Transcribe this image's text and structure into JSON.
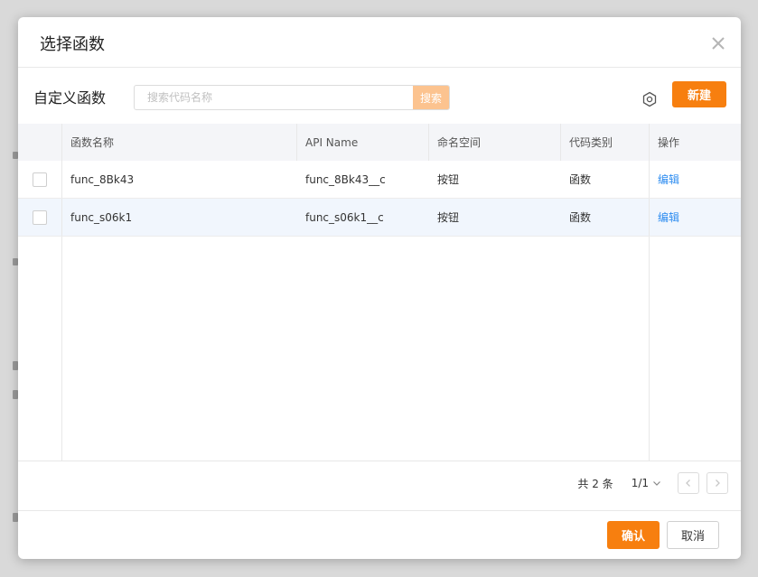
{
  "dialog": {
    "title": "选择函数"
  },
  "toolbar": {
    "title": "自定义函数",
    "search_placeholder": "搜索代码名称",
    "search_label": "搜索",
    "new_label": "新建"
  },
  "table": {
    "columns": [
      "函数名称",
      "API Name",
      "命名空间",
      "代码类别",
      "操作"
    ],
    "rows": [
      {
        "name": "func_8Bk43",
        "api": "func_8Bk43__c",
        "namespace": "按钮",
        "type": "函数",
        "action": "编辑"
      },
      {
        "name": "func_s06k1",
        "api": "func_s06k1__c",
        "namespace": "按钮",
        "type": "函数",
        "action": "编辑"
      }
    ]
  },
  "pagination": {
    "total": "共 2 条",
    "page": "1/1"
  },
  "footer": {
    "confirm_label": "确认",
    "cancel_label": "取消"
  },
  "colors": {
    "accent": "#f77f0f",
    "link": "#2d8cf0",
    "selected_row": "#f1f6fd"
  },
  "icons": [
    "close-icon",
    "settings-icon",
    "chevron-down-icon",
    "chevron-left-icon",
    "chevron-right-icon"
  ]
}
